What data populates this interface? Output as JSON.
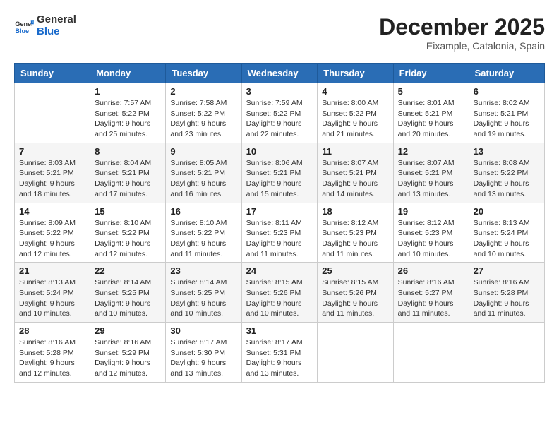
{
  "logo": {
    "line1": "General",
    "line2": "Blue"
  },
  "title": "December 2025",
  "subtitle": "Eixample, Catalonia, Spain",
  "days_of_week": [
    "Sunday",
    "Monday",
    "Tuesday",
    "Wednesday",
    "Thursday",
    "Friday",
    "Saturday"
  ],
  "weeks": [
    [
      {
        "day": "",
        "info": ""
      },
      {
        "day": "1",
        "info": "Sunrise: 7:57 AM\nSunset: 5:22 PM\nDaylight: 9 hours\nand 25 minutes."
      },
      {
        "day": "2",
        "info": "Sunrise: 7:58 AM\nSunset: 5:22 PM\nDaylight: 9 hours\nand 23 minutes."
      },
      {
        "day": "3",
        "info": "Sunrise: 7:59 AM\nSunset: 5:22 PM\nDaylight: 9 hours\nand 22 minutes."
      },
      {
        "day": "4",
        "info": "Sunrise: 8:00 AM\nSunset: 5:22 PM\nDaylight: 9 hours\nand 21 minutes."
      },
      {
        "day": "5",
        "info": "Sunrise: 8:01 AM\nSunset: 5:21 PM\nDaylight: 9 hours\nand 20 minutes."
      },
      {
        "day": "6",
        "info": "Sunrise: 8:02 AM\nSunset: 5:21 PM\nDaylight: 9 hours\nand 19 minutes."
      }
    ],
    [
      {
        "day": "7",
        "info": "Sunrise: 8:03 AM\nSunset: 5:21 PM\nDaylight: 9 hours\nand 18 minutes."
      },
      {
        "day": "8",
        "info": "Sunrise: 8:04 AM\nSunset: 5:21 PM\nDaylight: 9 hours\nand 17 minutes."
      },
      {
        "day": "9",
        "info": "Sunrise: 8:05 AM\nSunset: 5:21 PM\nDaylight: 9 hours\nand 16 minutes."
      },
      {
        "day": "10",
        "info": "Sunrise: 8:06 AM\nSunset: 5:21 PM\nDaylight: 9 hours\nand 15 minutes."
      },
      {
        "day": "11",
        "info": "Sunrise: 8:07 AM\nSunset: 5:21 PM\nDaylight: 9 hours\nand 14 minutes."
      },
      {
        "day": "12",
        "info": "Sunrise: 8:07 AM\nSunset: 5:21 PM\nDaylight: 9 hours\nand 13 minutes."
      },
      {
        "day": "13",
        "info": "Sunrise: 8:08 AM\nSunset: 5:22 PM\nDaylight: 9 hours\nand 13 minutes."
      }
    ],
    [
      {
        "day": "14",
        "info": "Sunrise: 8:09 AM\nSunset: 5:22 PM\nDaylight: 9 hours\nand 12 minutes."
      },
      {
        "day": "15",
        "info": "Sunrise: 8:10 AM\nSunset: 5:22 PM\nDaylight: 9 hours\nand 12 minutes."
      },
      {
        "day": "16",
        "info": "Sunrise: 8:10 AM\nSunset: 5:22 PM\nDaylight: 9 hours\nand 11 minutes."
      },
      {
        "day": "17",
        "info": "Sunrise: 8:11 AM\nSunset: 5:23 PM\nDaylight: 9 hours\nand 11 minutes."
      },
      {
        "day": "18",
        "info": "Sunrise: 8:12 AM\nSunset: 5:23 PM\nDaylight: 9 hours\nand 11 minutes."
      },
      {
        "day": "19",
        "info": "Sunrise: 8:12 AM\nSunset: 5:23 PM\nDaylight: 9 hours\nand 10 minutes."
      },
      {
        "day": "20",
        "info": "Sunrise: 8:13 AM\nSunset: 5:24 PM\nDaylight: 9 hours\nand 10 minutes."
      }
    ],
    [
      {
        "day": "21",
        "info": "Sunrise: 8:13 AM\nSunset: 5:24 PM\nDaylight: 9 hours\nand 10 minutes."
      },
      {
        "day": "22",
        "info": "Sunrise: 8:14 AM\nSunset: 5:25 PM\nDaylight: 9 hours\nand 10 minutes."
      },
      {
        "day": "23",
        "info": "Sunrise: 8:14 AM\nSunset: 5:25 PM\nDaylight: 9 hours\nand 10 minutes."
      },
      {
        "day": "24",
        "info": "Sunrise: 8:15 AM\nSunset: 5:26 PM\nDaylight: 9 hours\nand 10 minutes."
      },
      {
        "day": "25",
        "info": "Sunrise: 8:15 AM\nSunset: 5:26 PM\nDaylight: 9 hours\nand 11 minutes."
      },
      {
        "day": "26",
        "info": "Sunrise: 8:16 AM\nSunset: 5:27 PM\nDaylight: 9 hours\nand 11 minutes."
      },
      {
        "day": "27",
        "info": "Sunrise: 8:16 AM\nSunset: 5:28 PM\nDaylight: 9 hours\nand 11 minutes."
      }
    ],
    [
      {
        "day": "28",
        "info": "Sunrise: 8:16 AM\nSunset: 5:28 PM\nDaylight: 9 hours\nand 12 minutes."
      },
      {
        "day": "29",
        "info": "Sunrise: 8:16 AM\nSunset: 5:29 PM\nDaylight: 9 hours\nand 12 minutes."
      },
      {
        "day": "30",
        "info": "Sunrise: 8:17 AM\nSunset: 5:30 PM\nDaylight: 9 hours\nand 13 minutes."
      },
      {
        "day": "31",
        "info": "Sunrise: 8:17 AM\nSunset: 5:31 PM\nDaylight: 9 hours\nand 13 minutes."
      },
      {
        "day": "",
        "info": ""
      },
      {
        "day": "",
        "info": ""
      },
      {
        "day": "",
        "info": ""
      }
    ]
  ]
}
